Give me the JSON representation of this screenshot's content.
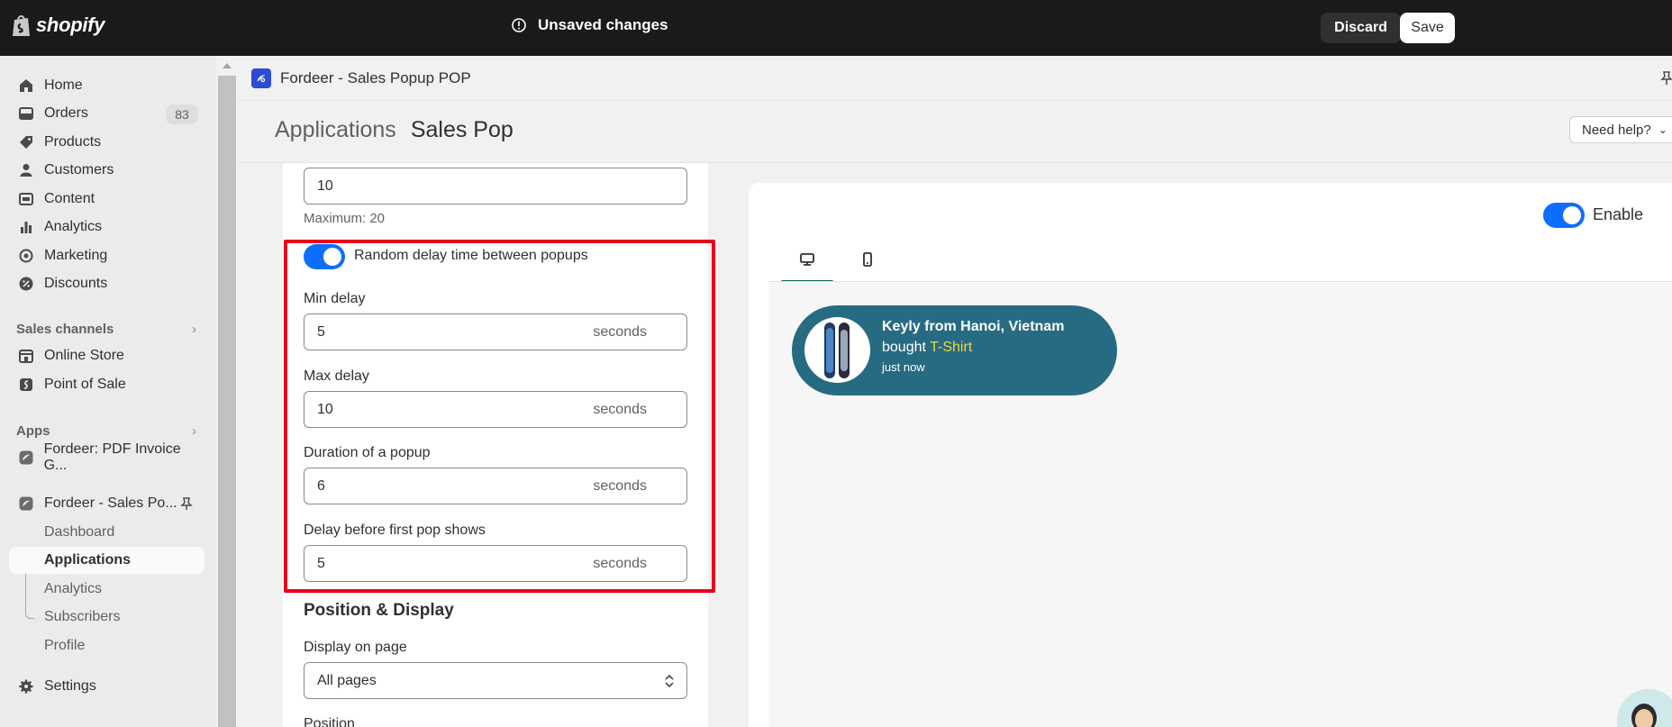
{
  "topbar": {
    "brand": "shopify",
    "unsaved_label": "Unsaved changes",
    "discard_label": "Discard",
    "save_label": "Save"
  },
  "sidebar": {
    "items": [
      {
        "label": "Home",
        "icon": "home-icon"
      },
      {
        "label": "Orders",
        "icon": "orders-icon",
        "badge": "83"
      },
      {
        "label": "Products",
        "icon": "tag-icon"
      },
      {
        "label": "Customers",
        "icon": "person-icon"
      },
      {
        "label": "Content",
        "icon": "content-icon"
      },
      {
        "label": "Analytics",
        "icon": "bar-chart-icon"
      },
      {
        "label": "Marketing",
        "icon": "target-icon"
      },
      {
        "label": "Discounts",
        "icon": "discount-icon"
      }
    ],
    "sales_channels_label": "Sales channels",
    "channels": [
      {
        "label": "Online Store",
        "icon": "store-icon"
      },
      {
        "label": "Point of Sale",
        "icon": "pos-icon"
      }
    ],
    "apps_label": "Apps",
    "apps": [
      {
        "label": "Fordeer: PDF Invoice G...",
        "icon": "app-icon"
      },
      {
        "label": "Fordeer - Sales Po...",
        "icon": "app-icon"
      }
    ],
    "app_subitems": [
      {
        "label": "Dashboard"
      },
      {
        "label": "Applications",
        "active": true
      },
      {
        "label": "Analytics"
      },
      {
        "label": "Subscribers"
      },
      {
        "label": "Profile"
      }
    ],
    "settings_label": "Settings"
  },
  "app_header": {
    "title": "Fordeer - Sales Popup POP"
  },
  "breadcrumb": {
    "parent": "Applications",
    "current": "Sales Pop"
  },
  "need_help_label": "Need help?",
  "settings": {
    "max_value": "10",
    "max_help": "Maximum: 20",
    "random_delay_label": "Random delay time between popups",
    "random_delay_enabled": true,
    "min_delay_label": "Min delay",
    "min_delay_value": "5",
    "max_delay_label": "Max delay",
    "max_delay_value": "10",
    "duration_label": "Duration of a popup",
    "duration_value": "6",
    "first_delay_label": "Delay before first pop shows",
    "first_delay_value": "5",
    "unit": "seconds",
    "position_display_title": "Position & Display",
    "display_on_page_label": "Display on page",
    "display_on_page_value": "All pages",
    "position_label": "Position"
  },
  "preview": {
    "enable_label": "Enable",
    "enabled": true,
    "popup": {
      "name": "Keyly from Hanoi, Vietnam",
      "bought_prefix": "bought ",
      "product": "T-Shirt",
      "time": "just now"
    }
  },
  "colors": {
    "topbar_bg": "#1a1a1a",
    "toggle_on": "#0d6efd",
    "popup_bg": "#276b82",
    "popup_product": "#f6d33e",
    "highlight_border": "#e8001c",
    "tab_indicator": "#0a6b5a"
  }
}
